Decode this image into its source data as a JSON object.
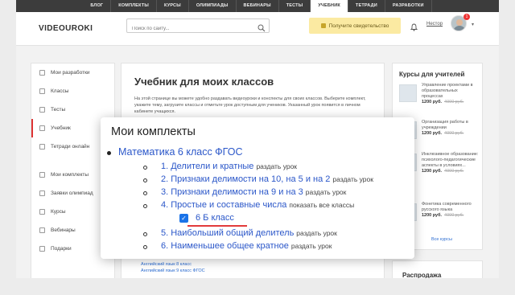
{
  "topnav": {
    "items": [
      "БЛОГ",
      "КОМПЛЕКТЫ",
      "КУРСЫ",
      "ОЛИМПИАДЫ",
      "ВЕБИНАРЫ",
      "ТЕСТЫ",
      "УЧЕБНИК",
      "ТЕТРАДИ",
      "РАЗРАБОТКИ"
    ],
    "active_index": 6
  },
  "header": {
    "logo": "VIDEOUROKI",
    "search_placeholder": "Поиск по сайту...",
    "certificate_button": "Получите свидетельство",
    "user_name": "Нестор",
    "notification_count": "1"
  },
  "sidebar": {
    "items": [
      "Мои разработки",
      "Классы",
      "Тесты",
      "Учебник",
      "Тетради онлайн",
      "Мои комплекты",
      "Заявки олимпиад",
      "Курсы",
      "Вебинары",
      "Подарки"
    ]
  },
  "main": {
    "title": "Учебник для моих классов",
    "intro": "На этой странице вы можете удобно раздавать видеоуроки и конспекты для своих классов. Выберите комплект, укажите тему, загрузите классы и отметьте урок доступным для учеников. Указанный урок появится в личном кабинете учащихся.",
    "bottom_links": [
      "Английский язык 8 класс",
      "Английский язык 9 класс ФГОС"
    ]
  },
  "right": {
    "title": "Курсы для учителей",
    "courses": [
      {
        "name": "Управление проектами в образовательных процессах",
        "price": "1200 руб.",
        "old_price": "4000 руб."
      },
      {
        "name": "Организация работы в учреждении",
        "price": "1200 руб.",
        "old_price": "4000 руб."
      },
      {
        "name": "Инклюзивное образование: психолого-педагогические аспекты в условиях...",
        "price": "1200 руб.",
        "old_price": "4000 руб."
      },
      {
        "name": "Фонетика современного русского языка",
        "price": "1200 руб.",
        "old_price": "4000 руб."
      }
    ],
    "all_courses": "Все курсы",
    "sale_title": "Распродажа"
  },
  "popup": {
    "title": "Мои комплекты",
    "set_name": "Математика 6 класс ФГОС",
    "topics": [
      {
        "label": "1. Делители и кратные",
        "action": "раздать урок"
      },
      {
        "label": "2. Признаки делимости на 10, на 5 и на 2",
        "action": "раздать урок"
      },
      {
        "label": "3. Признаки делимости на 9 и на 3",
        "action": "раздать урок"
      },
      {
        "label": "4. Простые и составные числа",
        "action": "показать все классы"
      },
      {
        "label": "5. Наибольший общий делитель",
        "action": "раздать урок"
      },
      {
        "label": "6. Наименьшее общее кратное",
        "action": "раздать урок"
      }
    ],
    "class_label": "6 Б класс",
    "class_checked": true
  }
}
